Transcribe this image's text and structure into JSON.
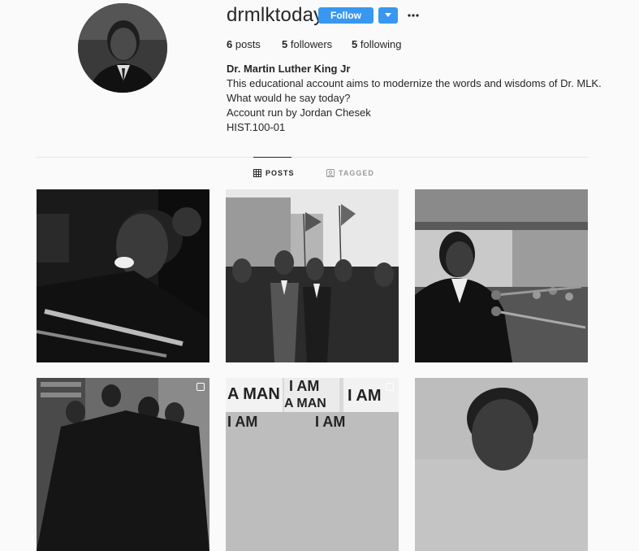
{
  "profile": {
    "username": "drmlktoday",
    "follow_label": "Follow",
    "more_label": "•••",
    "stats": {
      "posts_count": "6",
      "posts_label": "posts",
      "followers_count": "5",
      "followers_label": "followers",
      "following_count": "5",
      "following_label": "following"
    },
    "bio": {
      "full_name": "Dr. Martin Luther King Jr",
      "lines": [
        "This educational account aims to modernize the words and wisdoms of Dr. MLK.",
        "What would he say today?",
        "Account run by Jordan Chesek",
        "HIST.100-01"
      ]
    }
  },
  "tabs": {
    "posts_label": "POSTS",
    "tagged_label": "TAGGED",
    "active": "posts"
  },
  "posts_grid": {
    "posts": [
      {
        "description": "",
        "multi": false
      },
      {
        "description": "",
        "multi": false
      },
      {
        "description": "",
        "multi": false
      },
      {
        "description": "",
        "multi": true
      },
      {
        "description": "",
        "multi": true
      },
      {
        "description": "",
        "multi": false
      }
    ],
    "sign_text": {
      "i_am": "I AM",
      "a_man": "A MAN"
    }
  },
  "colors": {
    "accent": "#3897f0",
    "text": "#262626",
    "muted": "#999999",
    "background": "#fafafa",
    "divider": "#e6e6e6"
  }
}
